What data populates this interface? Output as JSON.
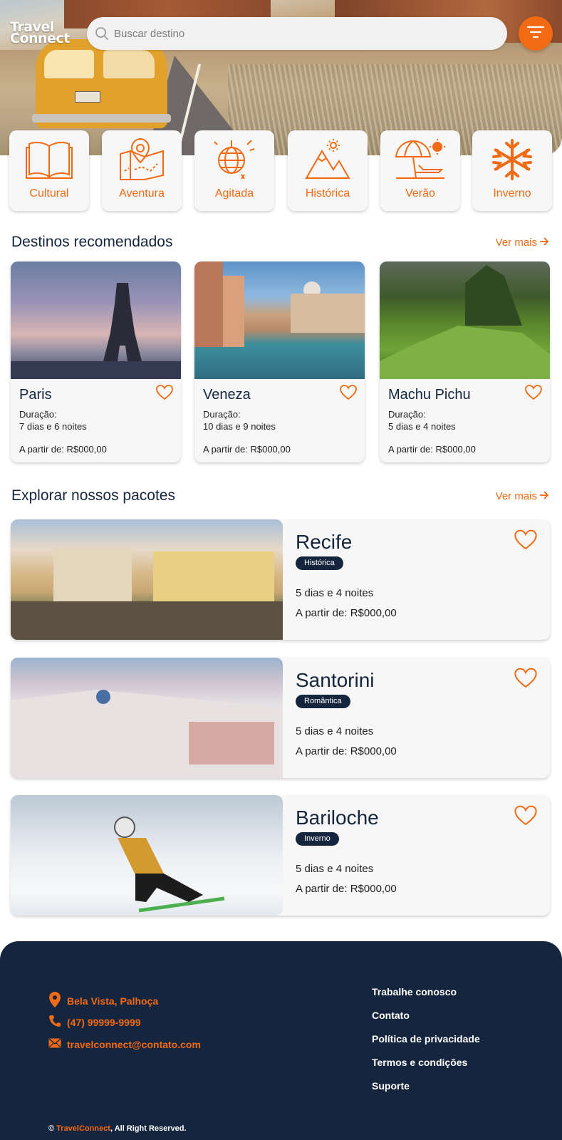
{
  "brand": {
    "logo_line1": "Travel",
    "logo_line2": "Connect"
  },
  "search": {
    "placeholder": "Buscar destino"
  },
  "icons": {
    "search": "search-icon",
    "filter": "filter-icon"
  },
  "colors": {
    "accent": "#f26a14",
    "navy": "#14253d",
    "card_bg": "#f7f7f7"
  },
  "categories": [
    {
      "label": "Cultural",
      "icon": "open-book-icon"
    },
    {
      "label": "Aventura",
      "icon": "map-pin-icon"
    },
    {
      "label": "Agitada",
      "icon": "disco-ball-icon"
    },
    {
      "label": "Histórica",
      "icon": "mountains-icon"
    },
    {
      "label": "Verão",
      "icon": "beach-umbrella-icon"
    },
    {
      "label": "Inverno",
      "icon": "snowflake-icon"
    }
  ],
  "recommended": {
    "title": "Destinos recomendados",
    "see_more": "Ver mais",
    "items": [
      {
        "name": "Paris",
        "duration_label": "Duração:",
        "duration": "7 dias e 6 noites",
        "price": "A partir de: R$000,00"
      },
      {
        "name": "Veneza",
        "duration_label": "Duração:",
        "duration": "10 dias e 9 noites",
        "price": "A partir de: R$000,00"
      },
      {
        "name": "Machu Pichu",
        "duration_label": "Duração:",
        "duration": "5 dias e 4 noites",
        "price": "A partir de: R$000,00"
      }
    ]
  },
  "packages": {
    "title": "Explorar nossos pacotes",
    "see_more": "Ver mais",
    "items": [
      {
        "name": "Recife",
        "badge": "Histórica",
        "days": "5 dias e 4 noites",
        "price": "A partir de: R$000,00"
      },
      {
        "name": "Santorini",
        "badge": "Romântica",
        "days": "5 dias e 4 noites",
        "price": "A partir de: R$000,00"
      },
      {
        "name": "Bariloche",
        "badge": "Inverno",
        "days": "5 dias e 4 noites",
        "price": "A partir de: R$000,00"
      }
    ]
  },
  "footer": {
    "address": "Bela Vista, Palhoça",
    "phone": "(47) 99999-9999",
    "email": "travelconnect@contato.com",
    "links": [
      "Trabalhe conosco",
      "Contato",
      "Política de privacidade",
      "Termos e condições",
      "Suporte"
    ],
    "copyright_prefix": "© ",
    "copyright_brand": "TravelConnect",
    "copyright_suffix": ", All Right Reserved."
  }
}
